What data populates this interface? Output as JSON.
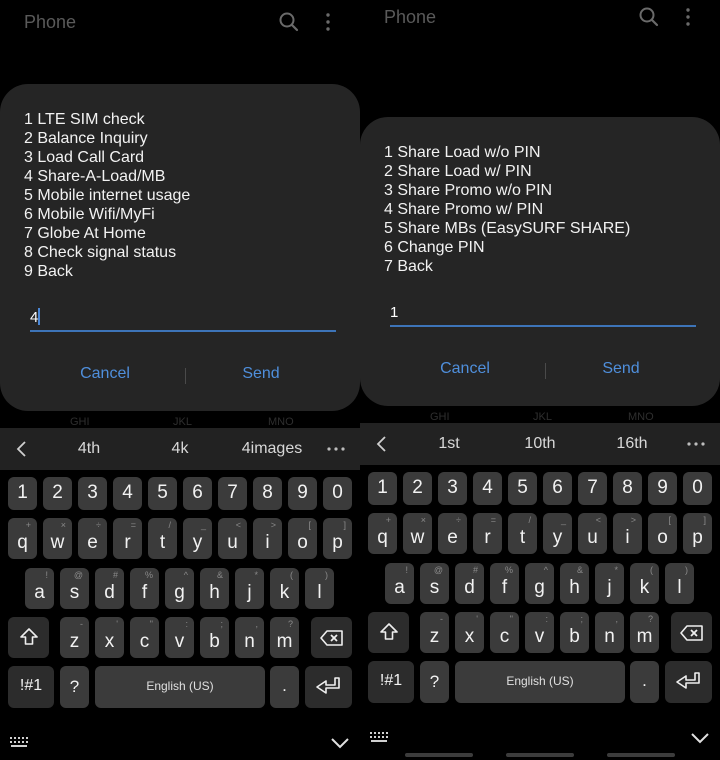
{
  "screens": [
    {
      "id": "left",
      "app_title": "Phone",
      "header_icons": [
        "search-icon",
        "more-vert-icon"
      ],
      "ussd_menu": [
        "1 LTE SIM check",
        "2 Balance Inquiry",
        "3 Load Call Card",
        "4 Share-A-Load/MB",
        "5 Mobile internet usage",
        "6 Mobile Wifi/MyFi",
        "7 Globe At Home",
        "8 Check signal status",
        "9 Back"
      ],
      "input_value": "4",
      "cancel_label": "Cancel",
      "send_label": "Send",
      "suggestions": [
        "4th",
        "4k",
        "4images"
      ]
    },
    {
      "id": "right",
      "app_title": "Phone",
      "header_icons": [
        "search-icon",
        "more-vert-icon"
      ],
      "ussd_menu": [
        "1 Share Load w/o PIN",
        "2 Share Load w/ PIN",
        "3 Share Promo w/o PIN",
        "4 Share Promo w/ PIN",
        "5 Share MBs (EasySURF SHARE)",
        "6 Change PIN",
        "7 Back"
      ],
      "input_value": "1",
      "cancel_label": "Cancel",
      "send_label": "Send",
      "suggestions": [
        "1st",
        "10th",
        "16th"
      ]
    }
  ],
  "keyboard": {
    "number_row": [
      "1",
      "2",
      "3",
      "4",
      "5",
      "6",
      "7",
      "8",
      "9",
      "0"
    ],
    "row1": [
      {
        "k": "q",
        "h": "+"
      },
      {
        "k": "w",
        "h": "×"
      },
      {
        "k": "e",
        "h": "÷"
      },
      {
        "k": "r",
        "h": "="
      },
      {
        "k": "t",
        "h": "/"
      },
      {
        "k": "y",
        "h": "_"
      },
      {
        "k": "u",
        "h": "<"
      },
      {
        "k": "i",
        "h": ">"
      },
      {
        "k": "o",
        "h": "["
      },
      {
        "k": "p",
        "h": "]"
      }
    ],
    "row2": [
      {
        "k": "a",
        "h": "!"
      },
      {
        "k": "s",
        "h": "@"
      },
      {
        "k": "d",
        "h": "#"
      },
      {
        "k": "f",
        "h": "%"
      },
      {
        "k": "g",
        "h": "^"
      },
      {
        "k": "h",
        "h": "&"
      },
      {
        "k": "j",
        "h": "*"
      },
      {
        "k": "k",
        "h": "("
      },
      {
        "k": "l",
        "h": ")"
      }
    ],
    "row3": [
      {
        "k": "z",
        "h": "-"
      },
      {
        "k": "x",
        "h": "'"
      },
      {
        "k": "c",
        "h": "\""
      },
      {
        "k": "v",
        "h": ":"
      },
      {
        "k": "b",
        "h": ";"
      },
      {
        "k": "n",
        "h": ","
      },
      {
        "k": "m",
        "h": "?"
      }
    ],
    "symbols_label": "!#1",
    "question_label": "?",
    "space_label": "English (US)",
    "period_label": "."
  },
  "colors": {
    "accent": "#4f8fdc",
    "dialog_bg": "#252525",
    "key_bg": "#3b3b3b"
  }
}
